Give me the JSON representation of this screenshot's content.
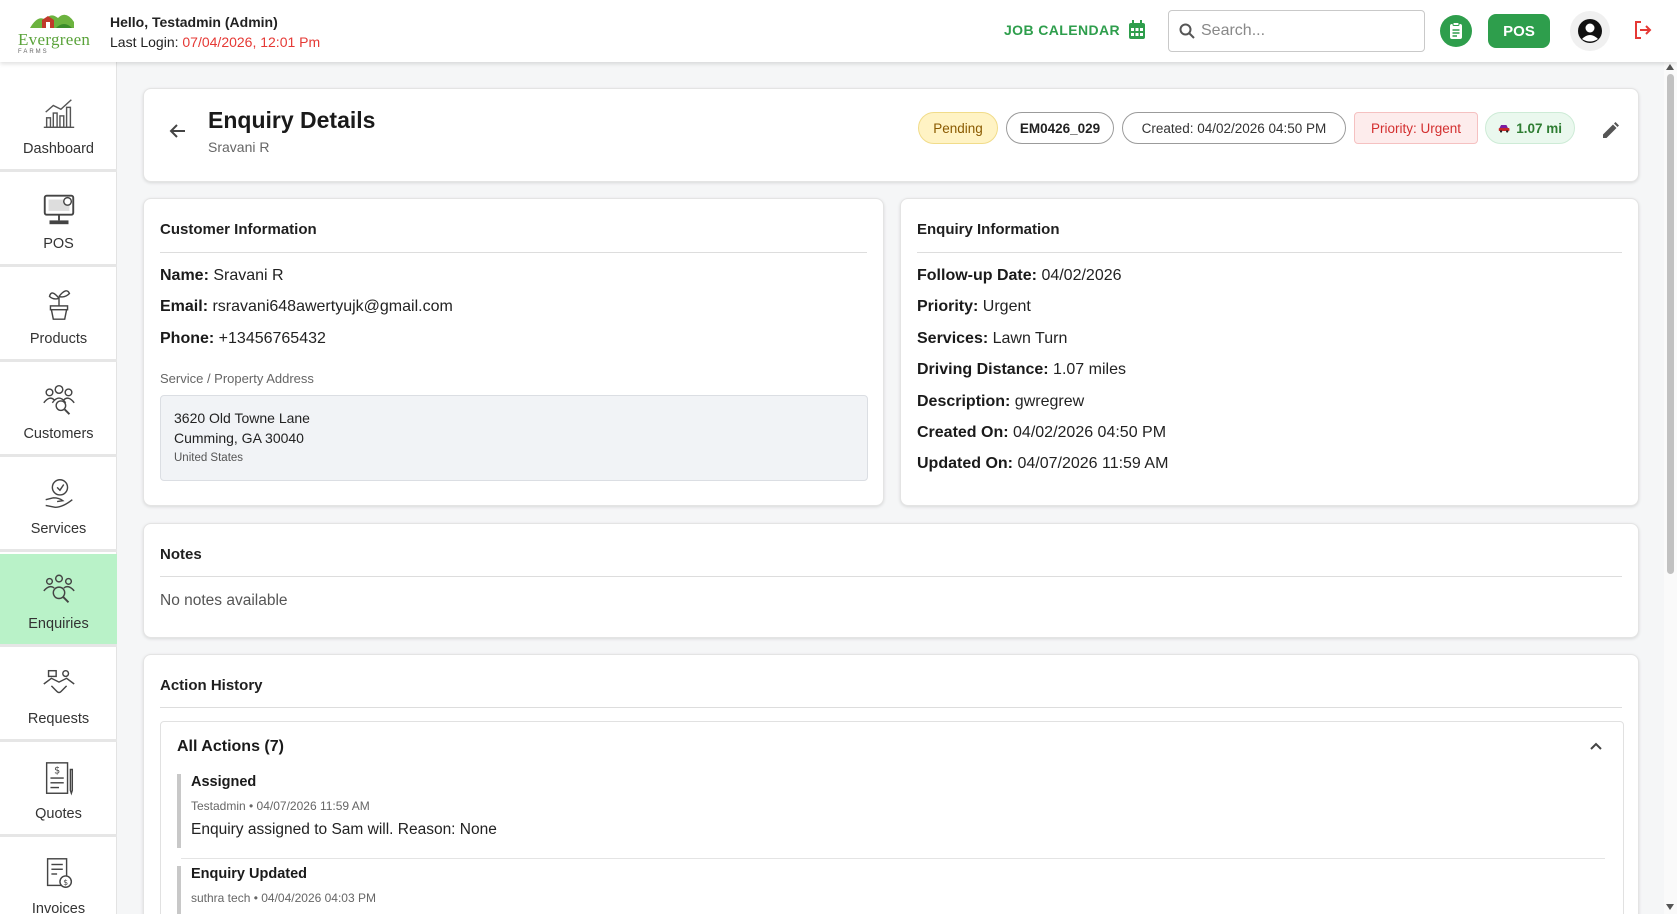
{
  "header": {
    "logo_text": "Evergreen",
    "logo_sub": "FARMS",
    "greeting": "Hello, Testadmin (Admin)",
    "last_login_label": "Last Login: ",
    "last_login_value": "07/04/2026, 12:01 Pm",
    "job_calendar": "JOB CALENDAR",
    "search_placeholder": "Search...",
    "pos_label": "POS",
    "accent_color": "#2e9e4c"
  },
  "sidebar": {
    "items": [
      {
        "label": "Dashboard",
        "icon": "dashboard-chart-icon"
      },
      {
        "label": "POS",
        "icon": "pos-terminal-icon"
      },
      {
        "label": "Products",
        "icon": "plant-pot-icon"
      },
      {
        "label": "Customers",
        "icon": "customers-group-icon"
      },
      {
        "label": "Services",
        "icon": "service-hand-icon"
      },
      {
        "label": "Enquiries",
        "icon": "enquiries-search-icon",
        "active": true
      },
      {
        "label": "Requests",
        "icon": "requests-handshake-icon"
      },
      {
        "label": "Quotes",
        "icon": "quote-document-icon"
      },
      {
        "label": "Invoices",
        "icon": "invoice-icon"
      }
    ],
    "active_color": "#b9f2c8"
  },
  "title_card": {
    "title": "Enquiry Details",
    "subtitle": "Sravani R",
    "status": "Pending",
    "code": "EM0426_029",
    "created": "Created: 04/02/2026 04:50 PM",
    "priority": "Priority: Urgent",
    "distance": "1.07 mi"
  },
  "customer_info": {
    "heading": "Customer Information",
    "name_label": "Name:",
    "name": "Sravani R",
    "email_label": "Email:",
    "email": "rsravani648awertyujk@gmail.com",
    "phone_label": "Phone:",
    "phone": "+13456765432",
    "address_label": "Service / Property Address",
    "address_line1": "3620 Old Towne Lane",
    "address_line2": "Cumming, GA 30040",
    "address_country": "United States"
  },
  "enquiry_info": {
    "heading": "Enquiry Information",
    "followup_label": "Follow-up Date:",
    "followup": "04/02/2026",
    "priority_label": "Priority:",
    "priority": "Urgent",
    "services_label": "Services:",
    "services": "Lawn Turn",
    "distance_label": "Driving Distance:",
    "distance": "1.07 miles",
    "description_label": "Description:",
    "description": "gwregrew",
    "created_label": "Created On:",
    "created": "04/02/2026 04:50 PM",
    "updated_label": "Updated On:",
    "updated": "04/07/2026 11:59 AM"
  },
  "notes": {
    "heading": "Notes",
    "empty": "No notes available"
  },
  "history": {
    "heading": "Action History",
    "all_actions": "All Actions (7)",
    "actions": [
      {
        "title": "Assigned",
        "meta": "Testadmin • 04/07/2026 11:59 AM",
        "detail": "Enquiry assigned to Sam will. Reason: None"
      },
      {
        "title": "Enquiry Updated",
        "meta": "suthra tech • 04/04/2026 04:03 PM",
        "detail": ""
      }
    ]
  }
}
